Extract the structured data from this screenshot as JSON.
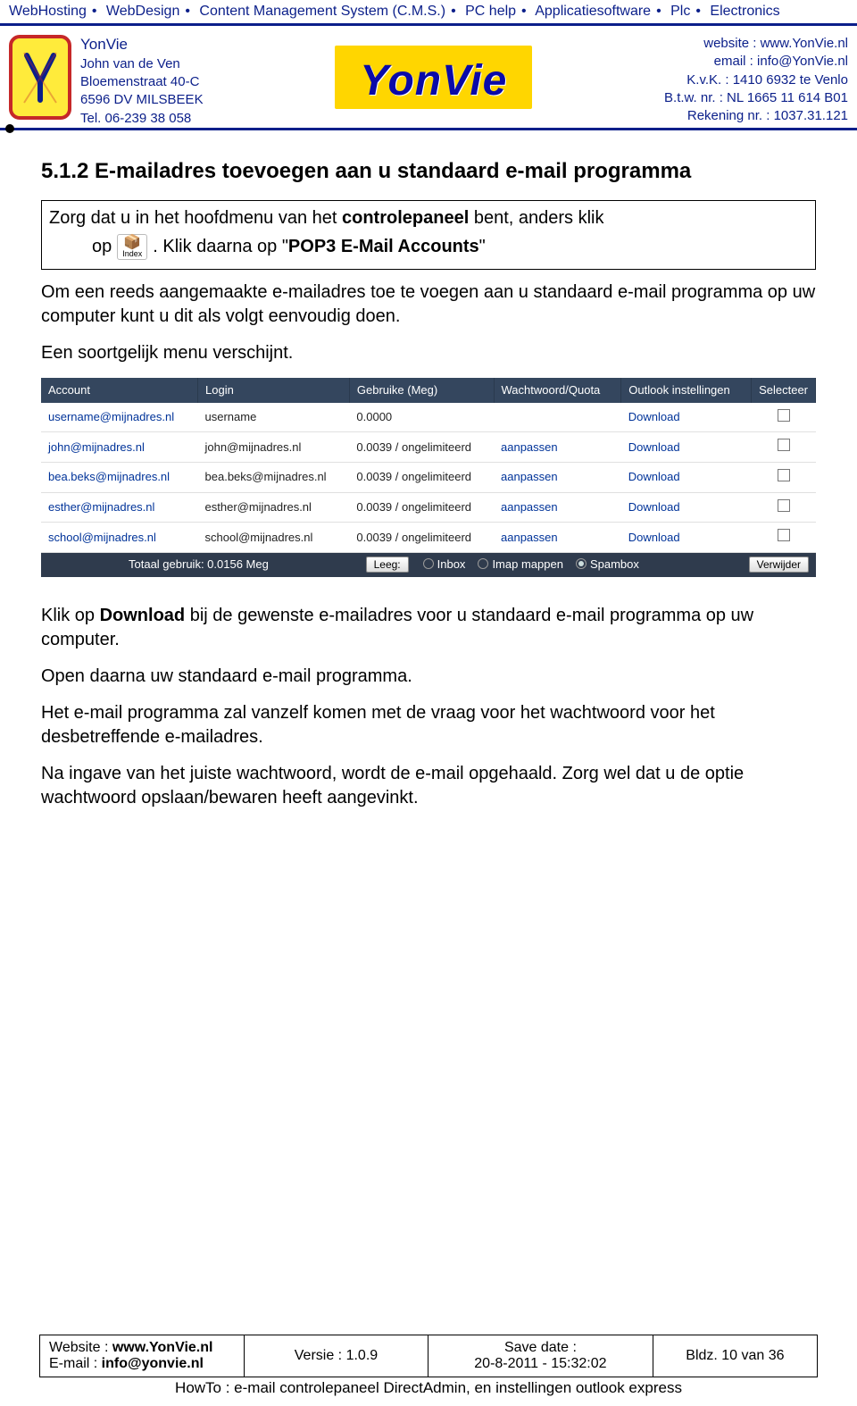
{
  "topnav": {
    "items": [
      "WebHosting",
      "WebDesign",
      "Content Management System (C.M.S.)",
      "PC help",
      "Applicatiesoftware",
      "Plc",
      "Electronics"
    ]
  },
  "header": {
    "addr": {
      "name": "YonVie",
      "line1": "John van de Ven",
      "line2": "Bloemenstraat 40-C",
      "line3": "6596 DV  MILSBEEK",
      "line4": "Tel. 06-239 38 058"
    },
    "brand": "YonVie",
    "right": {
      "l1": "website : www.YonVie.nl",
      "l2": "email : info@YonVie.nl",
      "l3": "K.v.K. : 1410 6932 te Venlo",
      "l4": "B.t.w. nr. : NL 1665 11 614 B01",
      "l5": "Rekening nr. : 1037.31.121"
    }
  },
  "body": {
    "sectionTitle": "5.1.2  E-mailadres toevoegen aan u standaard e-mail programma",
    "instrBox": {
      "line1_pre": "Zorg dat u in het hoofdmenu van het ",
      "line1_bold": "controlepaneel",
      "line1_post": " bent, anders klik",
      "op_label": "op",
      "indexBtn_label": "Index",
      "line2_pre": ".   Klik daarna op \"",
      "line2_bold": "POP3 E-Mail Accounts",
      "line2_post": "\""
    },
    "p1": "Om een reeds aangemaakte e-mailadres toe te voegen aan u standaard e-mail programma op uw computer kunt u dit als volgt eenvoudig doen.",
    "p2": "Een soortgelijk menu verschijnt.",
    "table": {
      "headers": [
        "Account",
        "Login",
        "Gebruike (Meg)",
        "Wachtwoord/Quota",
        "Outlook instellingen",
        "Selecteer"
      ],
      "rows": [
        {
          "acct": "username@mijnadres.nl",
          "login": "username",
          "usage": "0.0000",
          "pwd": "",
          "out": "Download"
        },
        {
          "acct": "john@mijnadres.nl",
          "login": "john@mijnadres.nl",
          "usage": "0.0039 / ongelimiteerd",
          "pwd": "aanpassen",
          "out": "Download"
        },
        {
          "acct": "bea.beks@mijnadres.nl",
          "login": "bea.beks@mijnadres.nl",
          "usage": "0.0039 / ongelimiteerd",
          "pwd": "aanpassen",
          "out": "Download"
        },
        {
          "acct": "esther@mijnadres.nl",
          "login": "esther@mijnadres.nl",
          "usage": "0.0039 / ongelimiteerd",
          "pwd": "aanpassen",
          "out": "Download"
        },
        {
          "acct": "school@mijnadres.nl",
          "login": "school@mijnadres.nl",
          "usage": "0.0039 / ongelimiteerd",
          "pwd": "aanpassen",
          "out": "Download"
        }
      ],
      "footer": {
        "total": "Totaal gebruik: 0.0156 Meg",
        "leegBtn": "Leeg:",
        "radios": [
          "Inbox",
          "Imap mappen",
          "Spambox"
        ],
        "selectedRadio": 2,
        "deleteBtn": "Verwijder"
      }
    },
    "p3_pre": "Klik op ",
    "p3_bold": "Download",
    "p3_post": " bij de gewenste e-mailadres voor u standaard e-mail programma op uw computer.",
    "p4": "Open daarna uw standaard e-mail programma.",
    "p5": "Het e-mail programma zal vanzelf komen met de vraag voor het wachtwoord voor het desbetreffende e-mailadres.",
    "p6": "Na ingave van het juiste wachtwoord, wordt de e-mail opgehaald. Zorg wel dat u de optie wachtwoord opslaan/bewaren heeft aangevinkt."
  },
  "footer": {
    "website_label": "Website : ",
    "website": "www.YonVie.nl",
    "email_label": "E-mail : ",
    "email": "info@yonvie.nl",
    "version_label": "Versie : ",
    "version": "1.0.9",
    "savedate_label": "Save date :",
    "savedate": "20-8-2011  -  15:32:02",
    "page": "Bldz. 10 van 36",
    "howto": "HowTo : e-mail controlepaneel DirectAdmin, en instellingen outlook express"
  }
}
